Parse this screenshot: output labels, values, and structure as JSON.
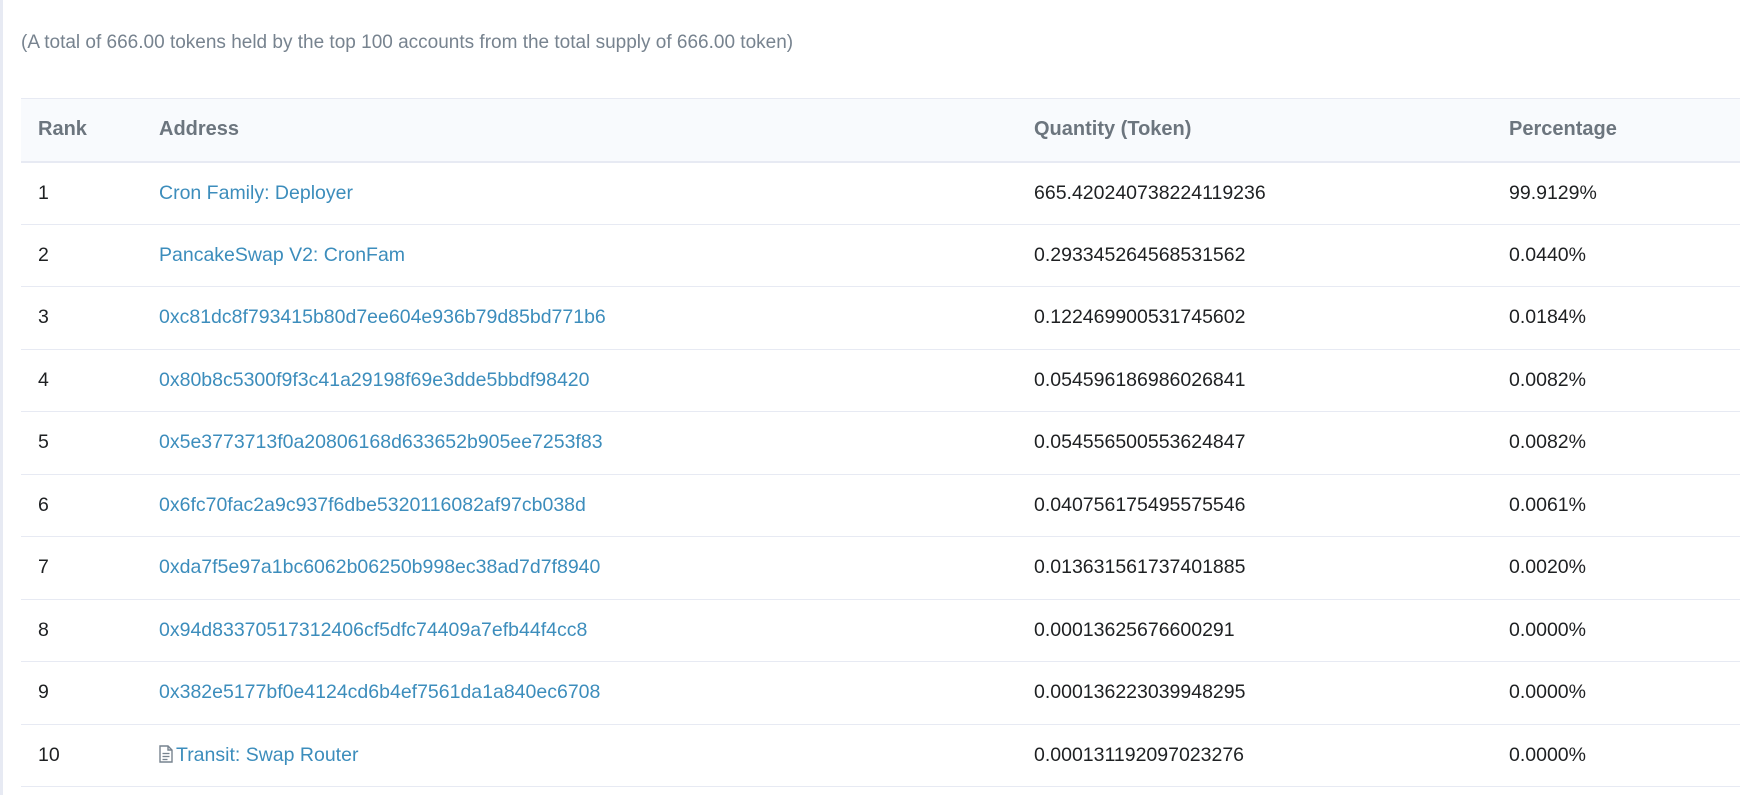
{
  "summary": "(A total of 666.00 tokens held by the top 100 accounts from the total supply of 666.00 token)",
  "table": {
    "headers": {
      "rank": "Rank",
      "address": "Address",
      "quantity": "Quantity (Token)",
      "percentage": "Percentage"
    },
    "rows": [
      {
        "rank": "1",
        "address": "Cron Family: Deployer",
        "quantity": "665.420240738224119236",
        "percentage": "99.9129%",
        "contract": false
      },
      {
        "rank": "2",
        "address": "PancakeSwap V2: CronFam",
        "quantity": "0.293345264568531562",
        "percentage": "0.0440%",
        "contract": false
      },
      {
        "rank": "3",
        "address": "0xc81dc8f793415b80d7ee604e936b79d85bd771b6",
        "quantity": "0.122469900531745602",
        "percentage": "0.0184%",
        "contract": false
      },
      {
        "rank": "4",
        "address": "0x80b8c5300f9f3c41a29198f69e3dde5bbdf98420",
        "quantity": "0.054596186986026841",
        "percentage": "0.0082%",
        "contract": false
      },
      {
        "rank": "5",
        "address": "0x5e3773713f0a20806168d633652b905ee7253f83",
        "quantity": "0.054556500553624847",
        "percentage": "0.0082%",
        "contract": false
      },
      {
        "rank": "6",
        "address": "0x6fc70fac2a9c937f6dbe5320116082af97cb038d",
        "quantity": "0.040756175495575546",
        "percentage": "0.0061%",
        "contract": false
      },
      {
        "rank": "7",
        "address": "0xda7f5e97a1bc6062b06250b998ec38ad7d7f8940",
        "quantity": "0.013631561737401885",
        "percentage": "0.0020%",
        "contract": false
      },
      {
        "rank": "8",
        "address": "0x94d83370517312406cf5dfc74409a7efb44f4cc8",
        "quantity": "0.00013625676600291",
        "percentage": "0.0000%",
        "contract": false
      },
      {
        "rank": "9",
        "address": "0x382e5177bf0e4124cd6b4ef7561da1a840ec6708",
        "quantity": "0.000136223039948295",
        "percentage": "0.0000%",
        "contract": false
      },
      {
        "rank": "10",
        "address": "Transit: Swap Router",
        "quantity": "0.000131192097023276",
        "percentage": "0.0000%",
        "contract": true,
        "icon": "contract-file-icon"
      }
    ]
  },
  "colors": {
    "link": "#3c8dbc",
    "text": "#1e2022",
    "muted": "#77838f",
    "header_bg": "#f8fafd",
    "border": "#e7eaf3"
  }
}
